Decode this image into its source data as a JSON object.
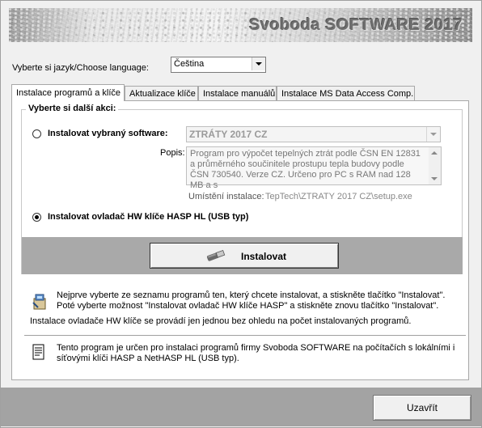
{
  "banner": {
    "title": "Svoboda SOFTWARE 2017"
  },
  "language": {
    "label": "Vyberte si jazyk/Choose language:",
    "selected": "Čeština"
  },
  "tabs": [
    {
      "label": "Instalace programů a klíče",
      "active": true
    },
    {
      "label": "Aktualizace klíče",
      "active": false
    },
    {
      "label": "Instalace manuálů",
      "active": false
    },
    {
      "label": "Instalace MS Data Access Comp.",
      "active": false
    }
  ],
  "group": {
    "title": "Vyberte si další akci:",
    "option_software": {
      "label": "Instalovat vybraný software:",
      "selected": false
    },
    "software_combo": {
      "value": "ZTRÁTY 2017 CZ"
    },
    "popis": {
      "label": "Popis:",
      "text": "Program pro výpočet tepelných ztrát podle ČSN EN 12831 a průměrného součinitele prostupu tepla budovy podle ČSN 730540. Verze CZ. Určeno pro PC s RAM nad 128 MB a s"
    },
    "install_path": {
      "label": "Umístění instalace:",
      "value": "TepTech\\ZTRATY 2017 CZ\\setup.exe"
    },
    "option_hasp": {
      "label": "Instalovat ovladač HW klíče HASP HL (USB typ)",
      "selected": true
    }
  },
  "install_button": {
    "label": "Instalovat"
  },
  "info": {
    "line1": "Nejprve vyberte ze seznamu programů ten, který chcete instalovat, a stiskněte tlačítko \"Instalovat\". Poté vyberte možnost \"Instalovat ovladač HW klíče HASP\" a stiskněte znovu tlačítko \"Instalovat\".",
    "line2": "Instalace ovladače HW klíče se provádí jen jednou bez ohledu na počet instalovaných programů.",
    "line3": "Tento program je určen pro instalaci programů firmy Svoboda SOFTWARE na počítačích s lokálními i síťovými klíči HASP a NetHASP HL (USB typ)."
  },
  "close_button": {
    "label": "Uzavřít"
  }
}
